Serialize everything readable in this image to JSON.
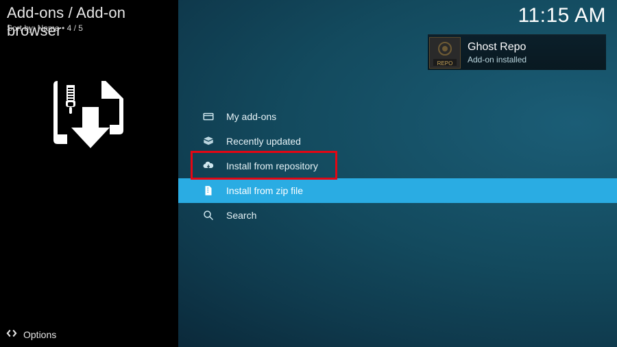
{
  "header": {
    "breadcrumb": "Add-ons / Add-on browser",
    "sort_line": "Sort by: Name • 4 / 5"
  },
  "clock": "11:15 AM",
  "toast": {
    "title": "Ghost Repo",
    "subtitle": "Add-on installed",
    "thumb_caption": "REPO"
  },
  "menu": {
    "items": [
      {
        "label": "My add-ons"
      },
      {
        "label": "Recently updated"
      },
      {
        "label": "Install from repository"
      },
      {
        "label": "Install from zip file"
      },
      {
        "label": "Search"
      }
    ],
    "selected_index": 3,
    "highlight_index": 2
  },
  "footer": {
    "options_label": "Options"
  }
}
